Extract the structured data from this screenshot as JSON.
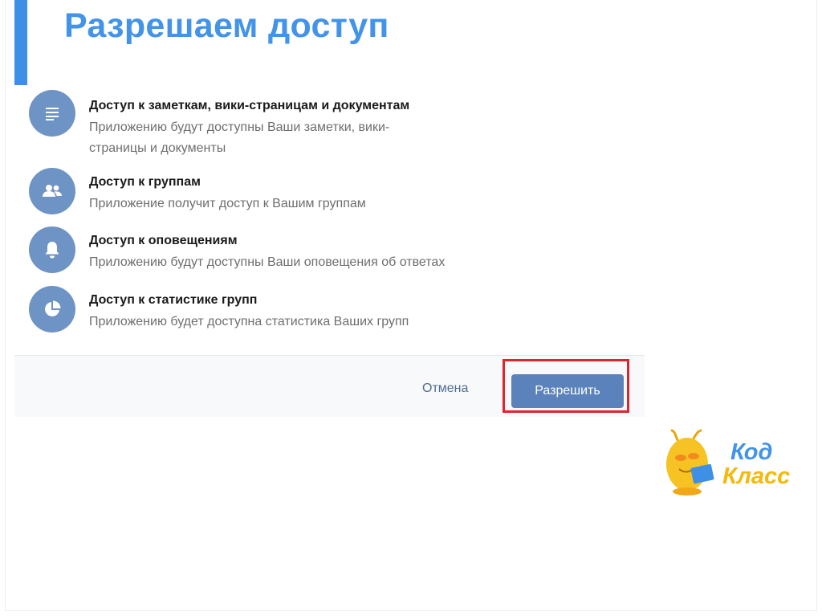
{
  "slide": {
    "title": "Разрешаем доступ"
  },
  "permissions": [
    {
      "icon": "document-icon",
      "title": "Доступ к заметкам, вики-страницам и документам",
      "desc_line1": "Приложению будут доступны Ваши заметки, вики-",
      "desc_line2": "страницы и документы"
    },
    {
      "icon": "groups-icon",
      "title": "Доступ к группам",
      "desc_line1": "Приложение получит доступ к Вашим группам"
    },
    {
      "icon": "bell-icon",
      "title": "Доступ к оповещениям",
      "desc_line1": "Приложению будут доступны Ваши оповещения об ответах"
    },
    {
      "icon": "pie-chart-icon",
      "title": "Доступ к статистике групп",
      "desc_line1": "Приложению будет доступна статистика Ваших групп"
    }
  ],
  "footer": {
    "cancel_label": "Отмена",
    "allow_label": "Разрешить"
  },
  "logo": {
    "line1": "Код",
    "line2": "Класс"
  },
  "colors": {
    "accent": "#4394e8",
    "icon_bg": "#6e93c5",
    "primary_button": "#5b82ba",
    "highlight": "#e0242c",
    "logo_yellow": "#f5b90b"
  }
}
